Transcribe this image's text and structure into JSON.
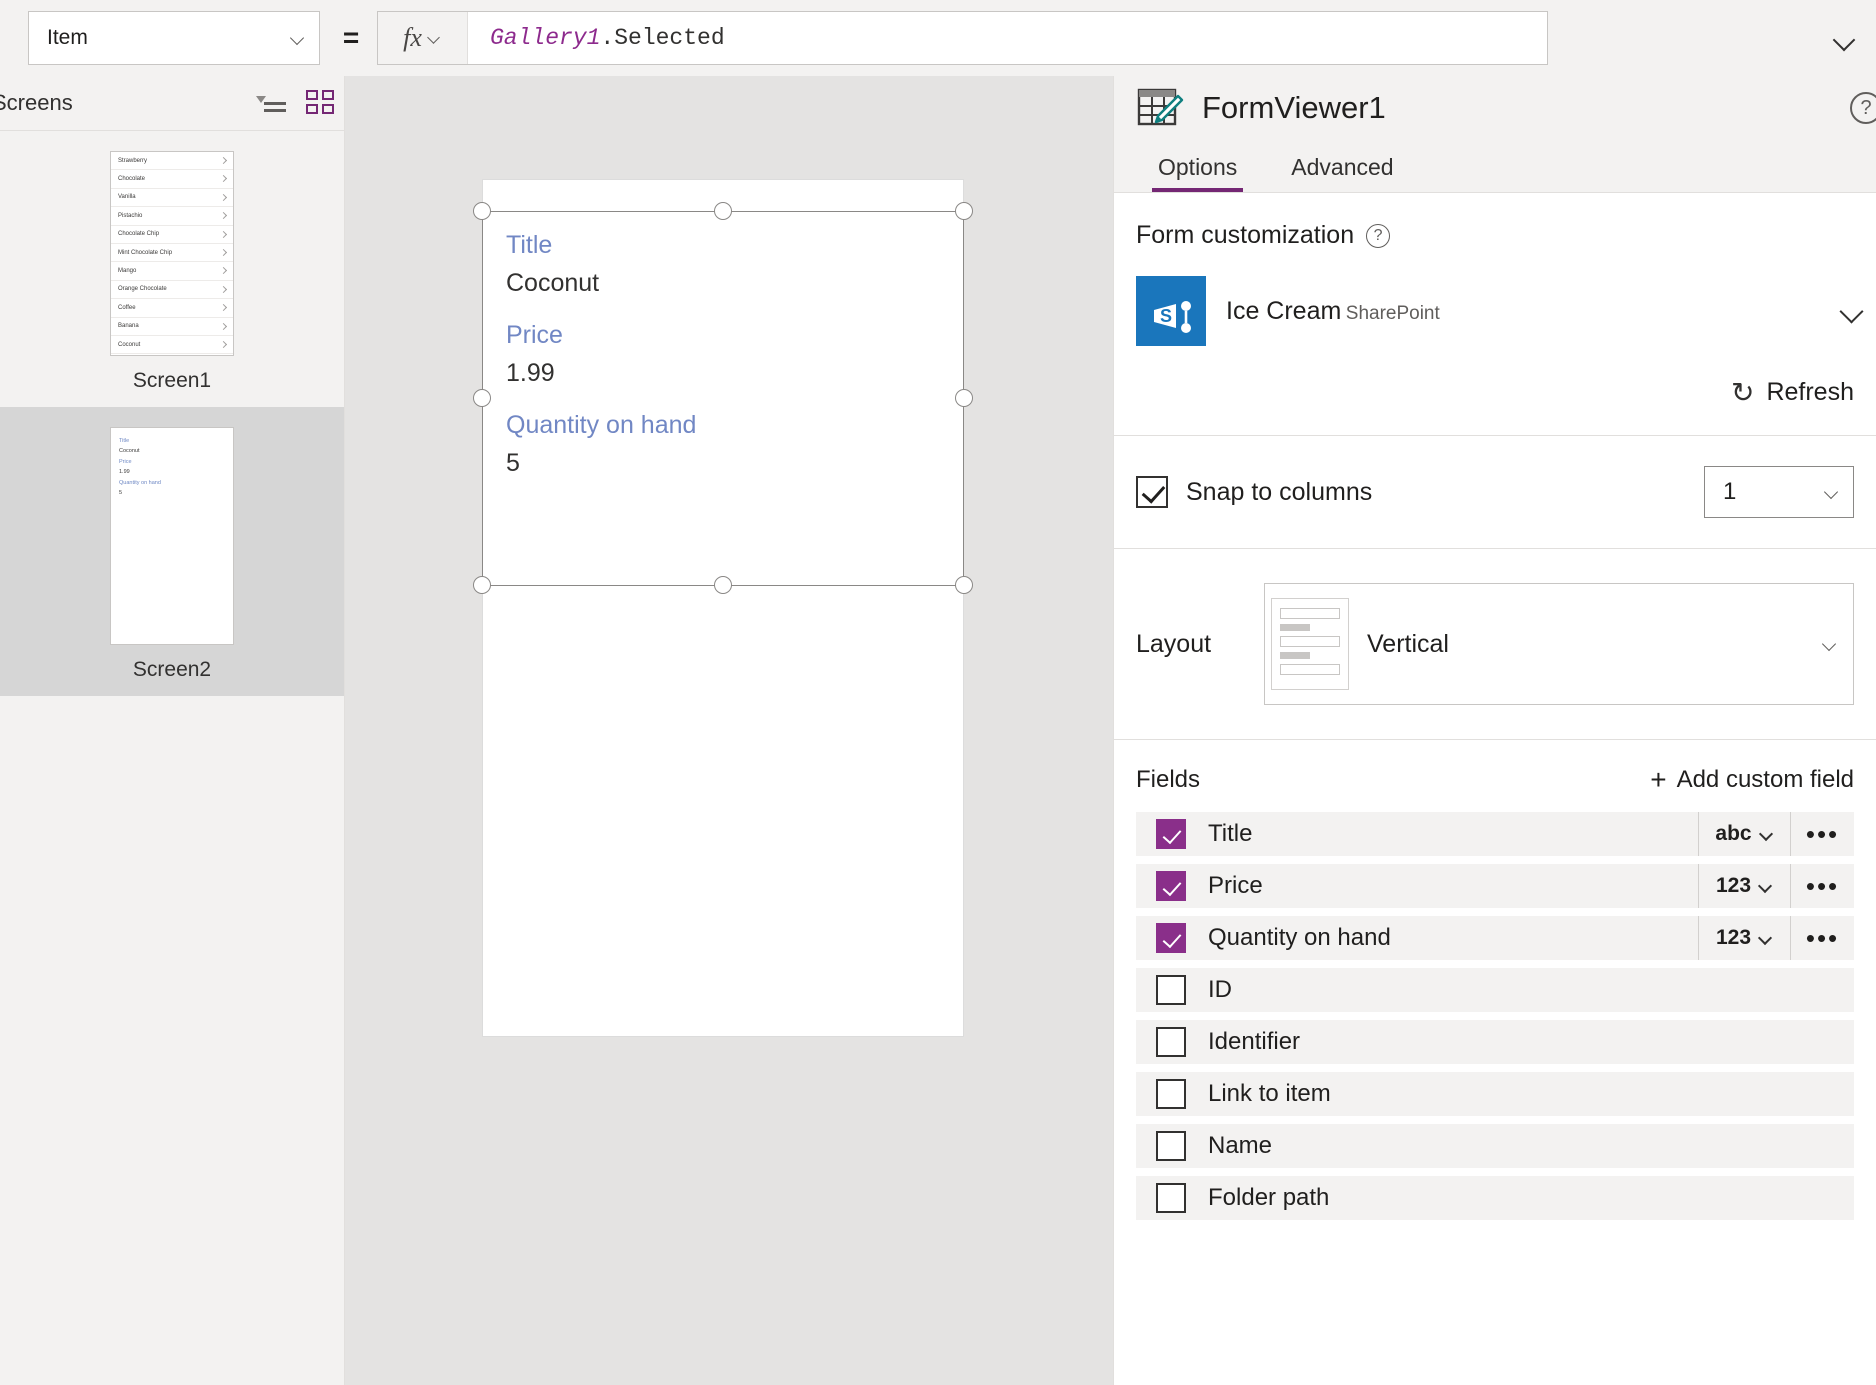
{
  "formula_bar": {
    "property": "Item",
    "equals": "=",
    "fx": "fx",
    "formula_identifier": "Gallery1",
    "formula_rest": ".Selected"
  },
  "tree_pane": {
    "title": "Screens",
    "view_list_icon": "list-view-icon",
    "view_grid_icon": "tile-view-icon",
    "screens": [
      {
        "caption": "Screen1",
        "selected": false
      },
      {
        "caption": "Screen2",
        "selected": true
      }
    ],
    "gallery_items": [
      "Strawberry",
      "Chocolate",
      "Vanilla",
      "Pistachio",
      "Chocolate Chip",
      "Mint Chocolate Chip",
      "Mango",
      "Orange Chocolate",
      "Coffee",
      "Banana",
      "Coconut"
    ],
    "thumb_form": [
      {
        "label": "Title",
        "value": "Coconut"
      },
      {
        "label": "Price",
        "value": "1.99"
      },
      {
        "label": "Quantity on hand",
        "value": "5"
      }
    ]
  },
  "canvas": {
    "form_fields": [
      {
        "label": "Title",
        "value": "Coconut"
      },
      {
        "label": "Price",
        "value": "1.99"
      },
      {
        "label": "Quantity on hand",
        "value": "5"
      }
    ]
  },
  "right_pane": {
    "title": "FormViewer1",
    "icon": "form-table-pencil-icon",
    "help_icon": "?",
    "tabs": [
      {
        "label": "Options",
        "active": true
      },
      {
        "label": "Advanced",
        "active": false
      }
    ],
    "form_customization": {
      "heading": "Form customization",
      "help": "?",
      "data_source_name": "Ice Cream",
      "data_source_account_redacted": "",
      "data_source_type": "SharePoint",
      "refresh_label": "Refresh",
      "refresh_icon": "refresh-icon"
    },
    "snap_to_columns": {
      "label": "Snap to columns",
      "checked": true,
      "columns_value": "1"
    },
    "layout": {
      "label": "Layout",
      "value": "Vertical",
      "preview_icon": "vertical-layout-preview-icon"
    },
    "fields": {
      "heading": "Fields",
      "add_label": "Add custom field",
      "add_icon": "plus-icon",
      "more_icon": "•••",
      "rows": [
        {
          "name": "Title",
          "checked": true,
          "type": "abc"
        },
        {
          "name": "Price",
          "checked": true,
          "type": "123"
        },
        {
          "name": "Quantity on hand",
          "checked": true,
          "type": "123"
        },
        {
          "name": "ID",
          "checked": false,
          "type": ""
        },
        {
          "name": "Identifier",
          "checked": false,
          "type": ""
        },
        {
          "name": "Link to item",
          "checked": false,
          "type": ""
        },
        {
          "name": "Name",
          "checked": false,
          "type": ""
        },
        {
          "name": "Folder path",
          "checked": false,
          "type": ""
        }
      ]
    }
  },
  "colors": {
    "accent_purple": "#742774",
    "check_purple": "#8a2f8a",
    "label_blue": "#7187c4",
    "sharepoint_blue": "#1a76bc",
    "pencil_teal": "#0f7f7f"
  }
}
